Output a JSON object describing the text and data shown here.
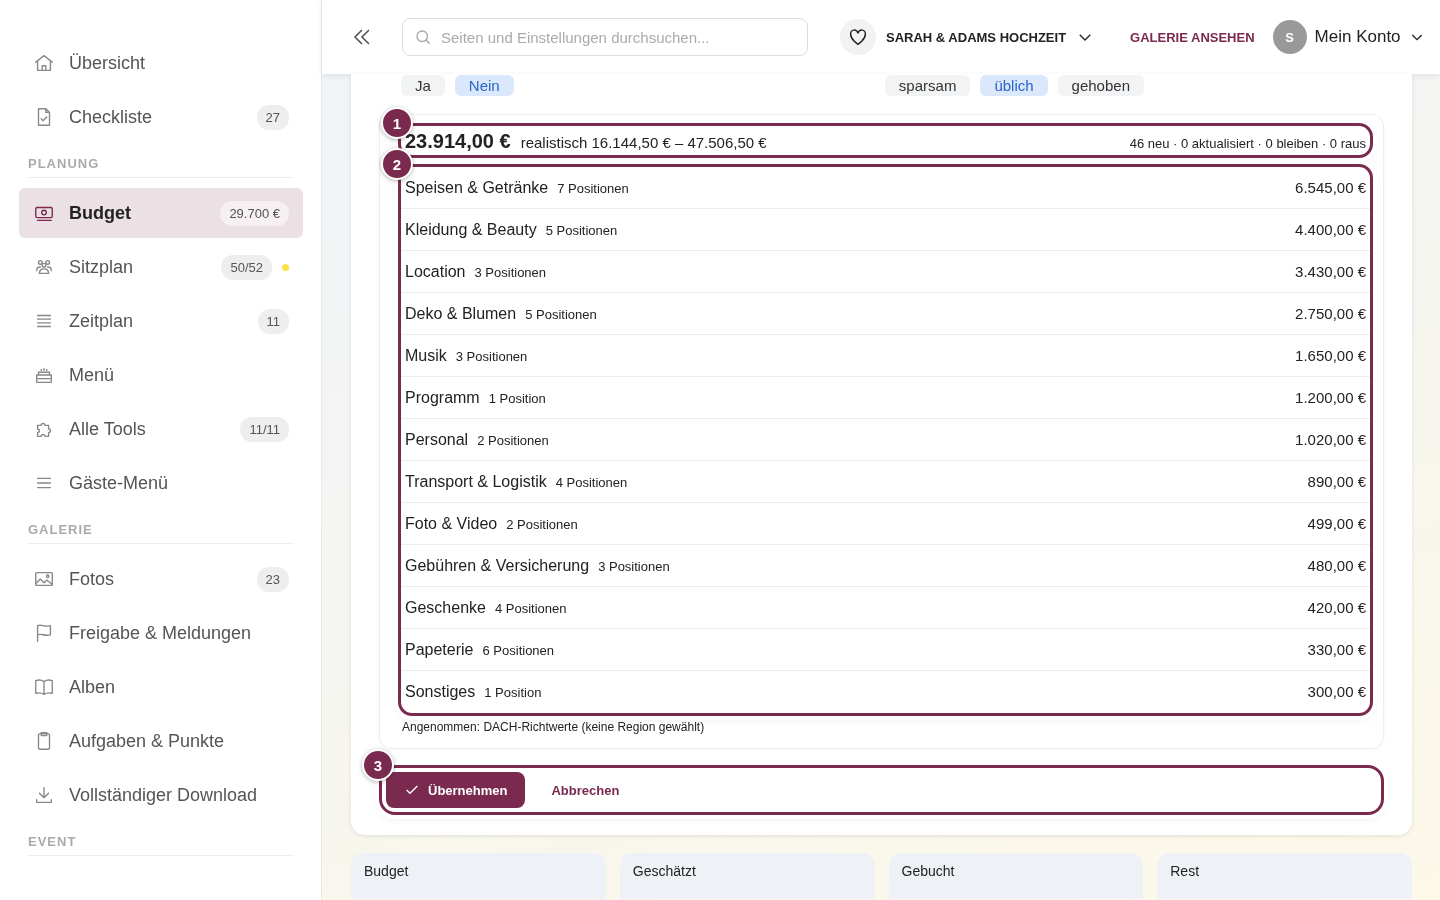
{
  "sidebar": {
    "sections": [
      {
        "items": [
          {
            "label": "Übersicht",
            "selected": false
          },
          {
            "label": "Checkliste",
            "badge": "27",
            "selected": false
          }
        ]
      },
      {
        "title": "PLANUNG",
        "items": [
          {
            "label": "Budget",
            "badge": "29.700 €",
            "selected": true
          },
          {
            "label": "Sitzplan",
            "badge": "50/52",
            "color": "#fde047",
            "selected": false
          },
          {
            "label": "Zeitplan",
            "badge": "11",
            "selected": false
          },
          {
            "label": "Menü",
            "selected": false
          },
          {
            "label": "Alle Tools",
            "badge": "11/11",
            "selected": false
          },
          {
            "label": "Gäste-Menü",
            "selected": false
          }
        ]
      },
      {
        "title": "GALERIE",
        "items": [
          {
            "label": "Fotos",
            "badge": "23",
            "selected": false
          },
          {
            "label": "Freigabe & Meldungen",
            "selected": false
          },
          {
            "label": "Alben",
            "selected": false
          },
          {
            "label": "Aufgaben & Punkte",
            "selected": false
          },
          {
            "label": "Vollständiger Download",
            "selected": false
          }
        ]
      },
      {
        "title": "EVENT"
      }
    ]
  },
  "header": {
    "search": {
      "placeholder": "Seiten und Einstellungen durchsuchen..."
    },
    "event": "SARAH & ADAMS HOCHZEIT",
    "gallery_link": "GALERIE ANSEHEN",
    "avatar": "S",
    "account": "Mein Konto"
  },
  "option_groups": [
    [
      {
        "label": "Ja",
        "selected": false
      },
      {
        "label": "Nein",
        "selected": true
      }
    ],
    [
      {
        "label": "sparsam",
        "selected": false
      },
      {
        "label": "üblich",
        "selected": true
      },
      {
        "label": "gehoben",
        "selected": false
      }
    ]
  ],
  "summary": {
    "step": "1",
    "total": "23.914,00 €",
    "range": "realistisch 16.144,50 € – 47.506,50 €",
    "changes": "46 neu · 0 aktualisiert · 0 bleiben · 0 raus"
  },
  "categories": {
    "step": "2",
    "rows": [
      {
        "name": "Speisen & Getränke",
        "count": "7 Positionen",
        "amount": "6.545,00 €"
      },
      {
        "name": "Kleidung & Beauty",
        "count": "5 Positionen",
        "amount": "4.400,00 €"
      },
      {
        "name": "Location",
        "count": "3 Positionen",
        "amount": "3.430,00 €"
      },
      {
        "name": "Deko & Blumen",
        "count": "5 Positionen",
        "amount": "2.750,00 €"
      },
      {
        "name": "Musik",
        "count": "3 Positionen",
        "amount": "1.650,00 €"
      },
      {
        "name": "Programm",
        "count": "1 Position",
        "amount": "1.200,00 €"
      },
      {
        "name": "Personal",
        "count": "2 Positionen",
        "amount": "1.020,00 €"
      },
      {
        "name": "Transport & Logistik",
        "count": "4 Positionen",
        "amount": "890,00 €"
      },
      {
        "name": "Foto & Video",
        "count": "2 Positionen",
        "amount": "499,00 €"
      },
      {
        "name": "Gebühren & Versicherung",
        "count": "3 Positionen",
        "amount": "480,00 €"
      },
      {
        "name": "Geschenke",
        "count": "4 Positionen",
        "amount": "420,00 €"
      },
      {
        "name": "Papeterie",
        "count": "6 Positionen",
        "amount": "330,00 €"
      },
      {
        "name": "Sonstiges",
        "count": "1 Position",
        "amount": "300,00 €"
      }
    ]
  },
  "note": "Angenommen: DACH-Richtwerte (keine Region gewählt)",
  "actions": {
    "step": "3",
    "apply": "Übernehmen",
    "cancel": "Abbrechen"
  },
  "stats": [
    "Budget",
    "Geschätzt",
    "Gebucht",
    "Rest"
  ]
}
